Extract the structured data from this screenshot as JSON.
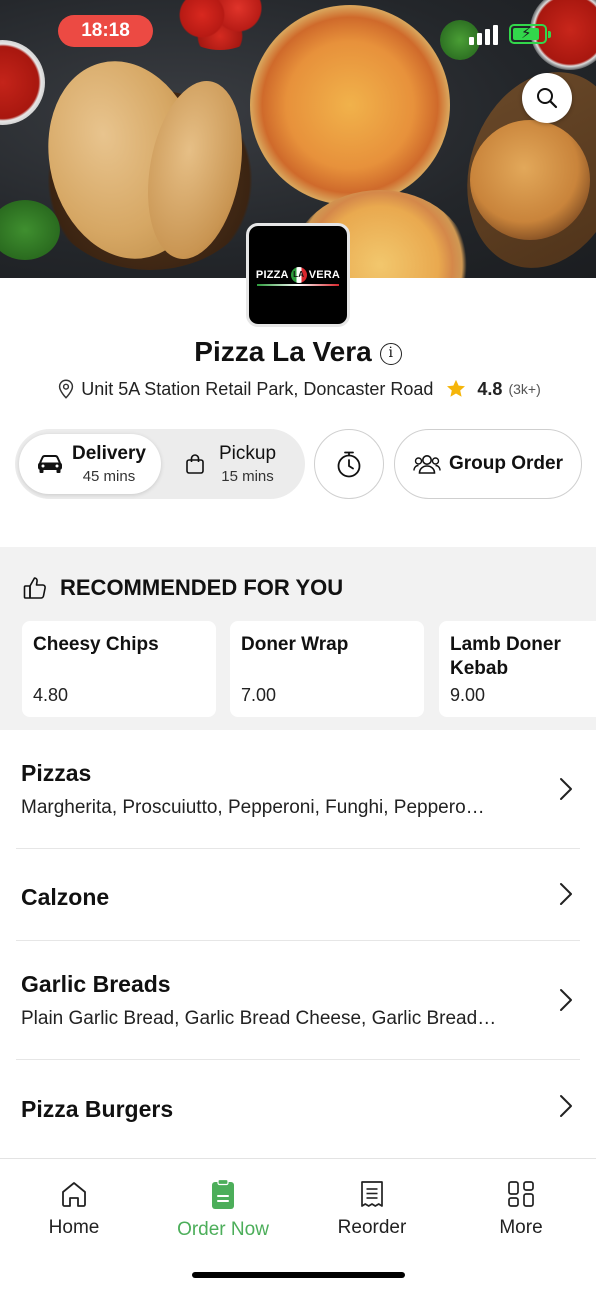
{
  "status_bar": {
    "time": "18:18"
  },
  "restaurant": {
    "logo_words": [
      "PIZZA",
      "LA",
      "VERA"
    ],
    "name": "Pizza La Vera",
    "address": "Unit 5A Station Retail Park, Doncaster Road",
    "rating": "4.8",
    "rating_count": "(3k+)"
  },
  "order_mode": {
    "delivery": {
      "label": "Delivery",
      "time": "45 mins",
      "selected": true
    },
    "pickup": {
      "label": "Pickup",
      "time": "15 mins",
      "selected": false
    }
  },
  "group_order_label": "Group Order",
  "recommended": {
    "heading": "RECOMMENDED FOR YOU",
    "items": [
      {
        "name": "Cheesy Chips",
        "price": "4.80"
      },
      {
        "name": "Doner Wrap",
        "price": "7.00"
      },
      {
        "name": "Lamb Doner Kebab",
        "price": "9.00"
      }
    ]
  },
  "categories": [
    {
      "title": "Pizzas",
      "description": "Margherita, Proscuiutto, Pepperoni, Funghi, Peppero…"
    },
    {
      "title": "Calzone",
      "description": ""
    },
    {
      "title": "Garlic Breads",
      "description": "Plain Garlic Bread, Garlic Bread Cheese, Garlic Bread…"
    },
    {
      "title": "Pizza Burgers",
      "description": ""
    }
  ],
  "tab_bar": {
    "items": [
      {
        "label": "Home",
        "icon": "home-icon",
        "active": false
      },
      {
        "label": "Order Now",
        "icon": "order-icon",
        "active": true
      },
      {
        "label": "Reorder",
        "icon": "receipt-icon",
        "active": false
      },
      {
        "label": "More",
        "icon": "grid-icon",
        "active": false
      }
    ]
  },
  "colors": {
    "accent_green": "#4cae5a",
    "status_pill_red": "#ec4a43",
    "star_yellow": "#f5b50a",
    "section_bg": "#f2f2f2"
  }
}
